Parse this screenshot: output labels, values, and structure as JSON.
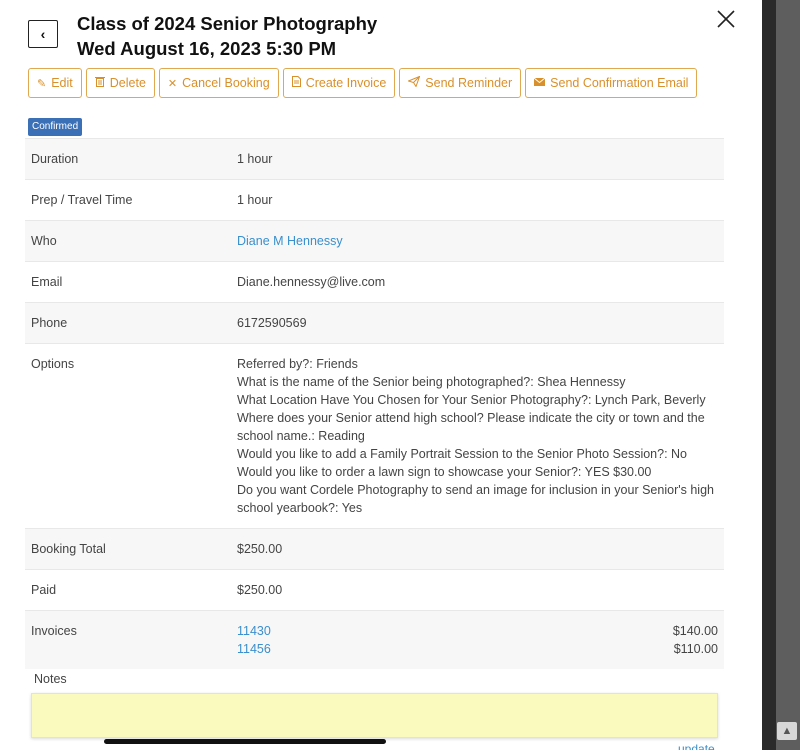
{
  "header": {
    "title_line1": "Class of 2024 Senior Photography",
    "title_line2": "Wed August 16, 2023 5:30 PM"
  },
  "toolbar": {
    "edit": "Edit",
    "delete": "Delete",
    "cancel_booking": "Cancel Booking",
    "create_invoice": "Create Invoice",
    "send_reminder": "Send Reminder",
    "send_confirmation": "Send Confirmation Email"
  },
  "status_badge": "Confirmed",
  "details": {
    "duration_label": "Duration",
    "duration_value": "1 hour",
    "prep_label": "Prep / Travel Time",
    "prep_value": "1 hour",
    "who_label": "Who",
    "who_value": "Diane M Hennessy",
    "email_label": "Email",
    "email_value": "Diane.hennessy@live.com",
    "phone_label": "Phone",
    "phone_value": "6172590569",
    "options_label": "Options",
    "options": [
      "Referred by?: Friends",
      "What is the name of the Senior being photographed?: Shea Hennessy",
      "What Location Have You Chosen for Your Senior Photography?: Lynch Park, Beverly",
      "Where does your Senior attend high school? Please indicate the city or town and the school name.: Reading",
      "Would you like to add a Family Portrait Session to the Senior Photo Session?: No",
      "Would you like to order a lawn sign to showcase your Senior?: YES $30.00",
      "Do you want Cordele Photography to send an image for inclusion in your Senior's high school yearbook?: Yes"
    ],
    "total_label": "Booking Total",
    "total_value": "$250.00",
    "paid_label": "Paid",
    "paid_value": "$250.00",
    "invoices_label": "Invoices",
    "invoices": [
      {
        "number": "11430",
        "amount": "$140.00"
      },
      {
        "number": "11456",
        "amount": "$110.00"
      }
    ]
  },
  "notes": {
    "label": "Notes",
    "value": "",
    "update_link": "update"
  },
  "colors": {
    "accent_orange": "#d9902b",
    "badge_blue": "#3b6fb6",
    "link_blue": "#3a8fcc",
    "notes_yellow": "#fafabe"
  },
  "icons": {
    "back": "chevron-left-icon",
    "close": "close-icon",
    "edit": "pencil-icon",
    "delete": "trash-icon",
    "cancel": "x-icon",
    "invoice": "document-icon",
    "reminder": "paper-plane-icon",
    "confirmation": "envelope-icon"
  }
}
